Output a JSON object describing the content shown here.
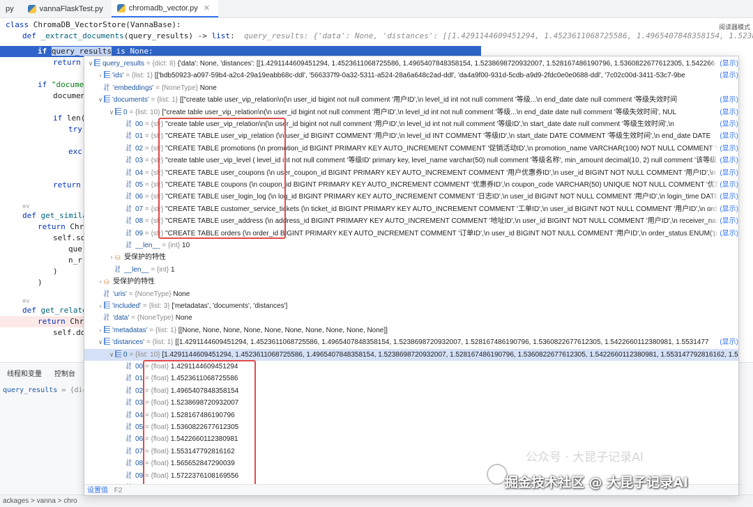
{
  "tabs": [
    {
      "label": "py",
      "active": false
    },
    {
      "label": "vannaFlaskTest.py",
      "active": false
    },
    {
      "label": "chromadb_vector.py",
      "active": true
    }
  ],
  "editor": {
    "reader_mode": "阅读器模式",
    "lines": [
      {
        "kw": "class ",
        "text": "ChromaDB_VectorStore(VannaBase):"
      },
      {
        "kw": "def ",
        "fn": "_extract_documents",
        "text": "(query_results) -> ",
        "kw2": "list",
        "tail": ":",
        "hint": "query_results: {'data': None, 'distances': [[1.4291144609451294, 1.4523611068725586, 1.4965407848358154, 1.5238698720932007, 1.52816748619"
      },
      {
        "kw": "if ",
        "sel": "query_results",
        "text": " is None:"
      },
      {
        "kw": "return",
        "text": ""
      },
      {
        "kw": "if ",
        "text": "\"documen"
      },
      {
        "text": "documen"
      },
      {
        "kw": "if ",
        "text": "len("
      },
      {
        "kw": "try",
        "text": ""
      },
      {
        "kw": "exc",
        "text": ""
      },
      {
        "kw": "return",
        "text": ""
      },
      {
        "kw": "def ",
        "fn": "get_similar",
        "text": ""
      },
      {
        "kw": "return ",
        "text": "Chro"
      },
      {
        "text": "self.sq"
      },
      {
        "text": "que"
      },
      {
        "text": "n_r"
      },
      {
        "text": ")"
      },
      {
        "text": ")"
      },
      {
        "kw": "def ",
        "fn": "get_related",
        "text": ""
      },
      {
        "kw": "return ",
        "text": "Chro"
      },
      {
        "text": "self.dd"
      }
    ],
    "fold_marks": [
      "⊕∨",
      "⊕∨"
    ]
  },
  "bottom": {
    "tabs": [
      "线程和变量",
      "控制台"
    ],
    "var_name": "query_results",
    "var_type": "= {dict: 8"
  },
  "status": {
    "path": "ackages > vanna > chro"
  },
  "popup": {
    "footer_action": "设置值",
    "footer_key": "F2",
    "show_label": "(显示)",
    "rows": [
      {
        "indent": 0,
        "arrow": "∨",
        "icon": "list",
        "name": "query_results",
        "type": " = {dict: 8} ",
        "value": "{'data': None, 'distances': [[1.4291144609451294, 1.4523611068725586, 1.4965407848358154, 1.5238698720932007, 1.528167486190796, 1.5360822677612305, 1.542266",
        "show": true
      },
      {
        "indent": 1,
        "arrow": "›",
        "icon": "list",
        "name": "'ids'",
        "type": " = {list: 1} ",
        "value": "[['bdb50923-a097-59b4-a2c4-29a19eabb68c-ddl', '566337f9-0a32-5311-a524-28a6a648c2ad-ddl', 'da4a9f00-931d-5cdb-a9d9-2fdc0e0e0688-ddl', '7c02c00d-3411-53c7-9be",
        "show": true
      },
      {
        "indent": 1,
        "arrow": "",
        "icon": "num",
        "name": "'embeddings'",
        "type": " = {NoneType} ",
        "value": "None",
        "show": false
      },
      {
        "indent": 1,
        "arrow": "∨",
        "icon": "list",
        "name": "'documents'",
        "type": " = {list: 1} ",
        "value": "[[\"create table user_vip_relation\\n(\\n    user_id    bigint not null comment '用户ID',\\n    level_id   int    not null comment '等级...\\n    end_date   date   null comment '等级失效时间",
        "show": true
      },
      {
        "indent": 2,
        "arrow": "∨",
        "icon": "list",
        "name": "0",
        "type": " = {list: 10} ",
        "value": "[\"create table user_vip_relation\\n(\\n    user_id    bigint not null comment '用户ID',\\n    level_id   int    not null comment '等级...\\n    end_date   date   null comment '等级失效时间', NUL",
        "show": true
      },
      {
        "indent": 3,
        "arrow": "",
        "icon": "num",
        "name": "00",
        "type": " = {str} ",
        "value": "\"create table user_vip_relation\\n(\\n    user_id    bigint not null comment '用户ID',\\n    level_id   int    not null comment '等级ID',\\n    start_date  date   null comment '等级生效时间',\\n",
        "show": true
      },
      {
        "indent": 3,
        "arrow": "",
        "icon": "num",
        "name": "01",
        "type": " = {str} ",
        "value": "\"CREATE TABLE user_vip_relation (\\n    user_id BIGINT COMMENT '用户ID',\\n    level_id INT COMMENT '等级ID',\\n    start_date DATE COMMENT '等级生效时间',\\n    end_date DATE",
        "show": true
      },
      {
        "indent": 3,
        "arrow": "",
        "icon": "num",
        "name": "02",
        "type": " = {str} ",
        "value": "\"CREATE TABLE promotions (\\n    promotion_id BIGINT PRIMARY KEY AUTO_INCREMENT COMMENT '促销活动ID',\\n    promotion_name VARCHAR(100) NOT NULL COMMENT '促销",
        "show": true
      },
      {
        "indent": 3,
        "arrow": "",
        "icon": "num",
        "name": "03",
        "type": " = {str} ",
        "value": "\"create table user_vip_level ( level_id int not null comment '等级ID' primary key, level_name varchar(50) null comment '等级名称', min_amount decimal(10, 2) null comment '该等级",
        "show": true
      },
      {
        "indent": 3,
        "arrow": "",
        "icon": "num",
        "name": "04",
        "type": " = {str} ",
        "value": "\"CREATE TABLE user_coupons (\\n    user_coupon_id BIGINT PRIMARY KEY AUTO_INCREMENT COMMENT '用户优惠券ID',\\n    user_id BIGINT NOT NULL COMMENT '用户ID',\\n    c",
        "show": true
      },
      {
        "indent": 3,
        "arrow": "",
        "icon": "num",
        "name": "05",
        "type": " = {str} ",
        "value": "\"CREATE TABLE coupons (\\n    coupon_id BIGINT PRIMARY KEY AUTO_INCREMENT COMMENT '优惠券ID',\\n    coupon_code VARCHAR(50) UNIQUE NOT NULL COMMENT '优惠券",
        "show": true
      },
      {
        "indent": 3,
        "arrow": "",
        "icon": "num",
        "name": "06",
        "type": " = {str} ",
        "value": "\"CREATE TABLE user_login_log (\\n    log_id BIGINT PRIMARY KEY AUTO_INCREMENT COMMENT '日志ID',\\n    user_id BIGINT NOT NULL COMMENT '用户ID',\\n    login_time DATE",
        "show": true
      },
      {
        "indent": 3,
        "arrow": "",
        "icon": "num",
        "name": "07",
        "type": " = {str} ",
        "value": "\"CREATE TABLE customer_service_tickets (\\n    ticket_id BIGINT PRIMARY KEY AUTO_INCREMENT COMMENT '工单ID',\\n    user_id BIGINT NOT NULL COMMENT '用户ID',\\n    orde",
        "show": true
      },
      {
        "indent": 3,
        "arrow": "",
        "icon": "num",
        "name": "08",
        "type": " = {str} ",
        "value": "\"CREATE TABLE user_address (\\n    address_id BIGINT PRIMARY KEY AUTO_INCREMENT COMMENT '地址ID',\\n    user_id BIGINT NOT NULL COMMENT '用户ID',\\n    receiver_nam",
        "show": true
      },
      {
        "indent": 3,
        "arrow": "",
        "icon": "num",
        "name": "09",
        "type": " = {str} ",
        "value": "\"CREATE TABLE orders (\\n    order_id BIGINT PRIMARY KEY AUTO_INCREMENT COMMENT '订单ID',\\n    user_id BIGINT NOT NULL COMMENT '用户ID',\\n    order_status ENUM('pe",
        "show": true
      },
      {
        "indent": 3,
        "arrow": "",
        "icon": "num",
        "name": "__len__",
        "type": " = {int} ",
        "value": "10",
        "show": false
      },
      {
        "indent": 2,
        "arrow": "›",
        "icon": "lock",
        "name": "受保护的特性",
        "type": "",
        "value": "",
        "show": false,
        "plain": true
      },
      {
        "indent": 2,
        "arrow": "",
        "icon": "num",
        "name": "__len__",
        "type": " = {int} ",
        "value": "1",
        "show": false
      },
      {
        "indent": 1,
        "arrow": "›",
        "icon": "lock",
        "name": "受保护的特性",
        "type": "",
        "value": "",
        "show": false,
        "plain": true
      },
      {
        "indent": 1,
        "arrow": "",
        "icon": "num",
        "name": "'uris'",
        "type": " = {NoneType} ",
        "value": "None",
        "show": false
      },
      {
        "indent": 1,
        "arrow": "›",
        "icon": "list",
        "name": "'included'",
        "type": " = {list: 3} ",
        "value": "['metadatas', 'documents', 'distances']",
        "show": false
      },
      {
        "indent": 1,
        "arrow": "",
        "icon": "num",
        "name": "'data'",
        "type": " = {NoneType} ",
        "value": "None",
        "show": false
      },
      {
        "indent": 1,
        "arrow": "›",
        "icon": "list",
        "name": "'metadatas'",
        "type": " = {list: 1} ",
        "value": "[[None, None, None, None, None, None, None, None, None, None]]",
        "show": false
      },
      {
        "indent": 1,
        "arrow": "∨",
        "icon": "list",
        "name": "'distances'",
        "type": " = {list: 1} ",
        "value": "[[1.4291144609451294, 1.4523611068725586, 1.4965407848358154, 1.5238698720932007, 1.528167486190796, 1.5360822677612305, 1.5422660112380981, 1.5531477",
        "show": true
      },
      {
        "indent": 2,
        "arrow": "∨",
        "icon": "list",
        "name": "0",
        "type": " = {list: 10} ",
        "value": "[1.4291144609451294, 1.4523611068725586, 1.4965407848358154, 1.5238698720932007, 1.528167486190796, 1.5360822677612305, 1.5422660112380981, 1.553147792816162, 1.56",
        "show": false,
        "selected": true
      },
      {
        "indent": 3,
        "arrow": "",
        "icon": "num",
        "name": "00",
        "type": " = {float} ",
        "value": "1.4291144609451294",
        "show": false
      },
      {
        "indent": 3,
        "arrow": "",
        "icon": "num",
        "name": "01",
        "type": " = {float} ",
        "value": "1.4523611068725586",
        "show": false
      },
      {
        "indent": 3,
        "arrow": "",
        "icon": "num",
        "name": "02",
        "type": " = {float} ",
        "value": "1.4965407848358154",
        "show": false
      },
      {
        "indent": 3,
        "arrow": "",
        "icon": "num",
        "name": "03",
        "type": " = {float} ",
        "value": "1.5238698720932007",
        "show": false
      },
      {
        "indent": 3,
        "arrow": "",
        "icon": "num",
        "name": "04",
        "type": " = {float} ",
        "value": "1.528167486190796",
        "show": false
      },
      {
        "indent": 3,
        "arrow": "",
        "icon": "num",
        "name": "05",
        "type": " = {float} ",
        "value": "1.5360822677612305",
        "show": false
      },
      {
        "indent": 3,
        "arrow": "",
        "icon": "num",
        "name": "06",
        "type": " = {float} ",
        "value": "1.5422660112380981",
        "show": false
      },
      {
        "indent": 3,
        "arrow": "",
        "icon": "num",
        "name": "07",
        "type": " = {float} ",
        "value": "1.553147792816162",
        "show": false
      },
      {
        "indent": 3,
        "arrow": "",
        "icon": "num",
        "name": "08",
        "type": " = {float} ",
        "value": "1.565652847290039",
        "show": false
      },
      {
        "indent": 3,
        "arrow": "",
        "icon": "num",
        "name": "09",
        "type": " = {float} ",
        "value": "1.5722376108169556",
        "show": false
      },
      {
        "indent": 3,
        "arrow": "",
        "icon": "num",
        "name": "__len__",
        "type": " = {int} ",
        "value": "10",
        "show": false
      }
    ]
  },
  "watermark": {
    "line1": "公众号 · 大昆子记录AI",
    "line2": "掘金技术社区 @ 大昆子记录AI"
  },
  "colors": {
    "accent": "#3574f0",
    "highlight_box": "#e04a4a",
    "selection": "#2f65ca"
  }
}
